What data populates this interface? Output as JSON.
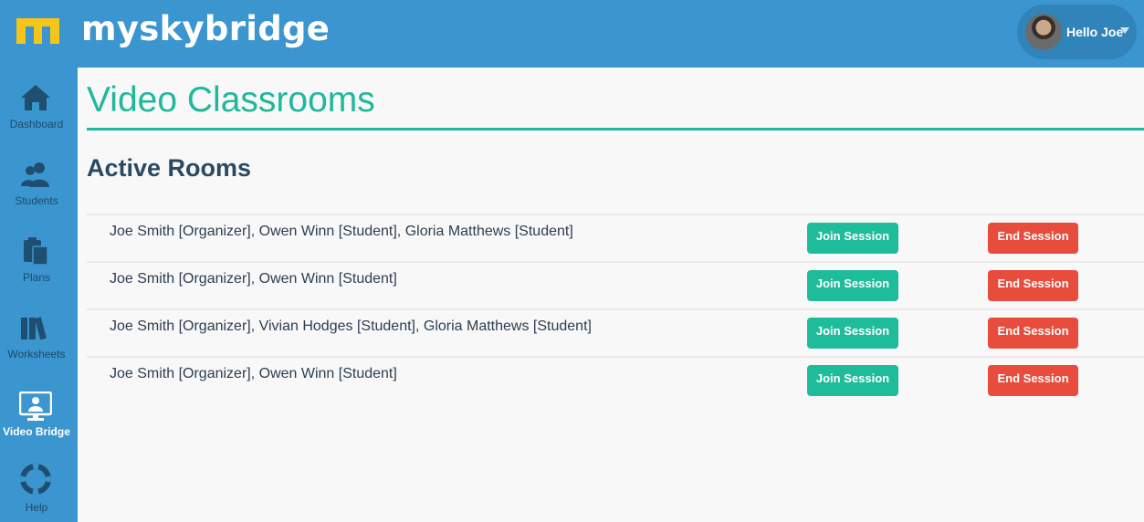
{
  "header": {
    "brand": "myskybridge",
    "greeting": "Hello Joe",
    "colors": {
      "bar": "#3b95cf",
      "logo": "#f5c518"
    }
  },
  "sidebar": {
    "items": [
      {
        "label": "Dashboard",
        "icon": "home-icon"
      },
      {
        "label": "Students",
        "icon": "users-icon"
      },
      {
        "label": "Plans",
        "icon": "clipboard-icon"
      },
      {
        "label": "Worksheets",
        "icon": "books-icon"
      },
      {
        "label": "Video Bridge",
        "icon": "monitor-icon",
        "active": true
      },
      {
        "label": "Help",
        "icon": "lifebuoy-icon"
      }
    ]
  },
  "main": {
    "title": "Video Classrooms",
    "section_title": "Active Rooms",
    "rooms": [
      {
        "participants": "Joe Smith [Organizer], Owen Winn [Student], Gloria Matthews [Student]",
        "join_label": "Join Session",
        "end_label": "End Session"
      },
      {
        "participants": "Joe Smith [Organizer], Owen Winn [Student]",
        "join_label": "Join Session",
        "end_label": "End Session"
      },
      {
        "participants": "Joe Smith [Organizer], Vivian Hodges [Student], Gloria Matthews [Student]",
        "join_label": "Join Session",
        "end_label": "End Session"
      },
      {
        "participants": "Joe Smith [Organizer], Owen Winn [Student]",
        "join_label": "Join Session",
        "end_label": "End Session"
      }
    ],
    "colors": {
      "accent": "#1fb89b",
      "join": "#1fbc9c",
      "end": "#e74c3c"
    }
  }
}
